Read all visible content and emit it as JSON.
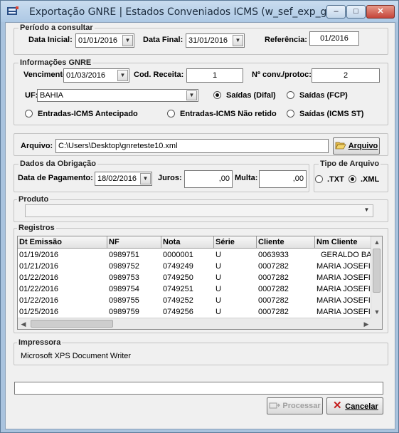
{
  "window": {
    "title": "Exportação GNRE  |  Estados Conveniados ICMS (w_sef_exp_gnre)",
    "min_glyph": "–",
    "max_glyph": "□",
    "close_glyph": "✕"
  },
  "periodo": {
    "legend": "Período a consultar",
    "data_inicial_label": "Data Inicial:",
    "data_inicial_value": "01/01/2016",
    "data_final_label": "Data Final:",
    "data_final_value": "31/01/2016",
    "referencia_label": "Referência:",
    "referencia_value": "01/2016"
  },
  "gnre": {
    "legend": "Informações GNRE",
    "vencimento_label": "Vencimento:",
    "vencimento_value": "01/03/2016",
    "cod_receita_label": "Cod. Receita:",
    "cod_receita_value": "1",
    "nconv_label": "Nº conv./protoc:",
    "nconv_value": "2",
    "uf_label": "UF:",
    "uf_value": "BAHIA",
    "radios": [
      {
        "label": "Saídas (Difal)",
        "selected": true
      },
      {
        "label": "Saídas (FCP)",
        "selected": false
      },
      {
        "label": "Entradas-ICMS Antecipado",
        "selected": false
      },
      {
        "label": "Entradas-ICMS Não retido",
        "selected": false
      },
      {
        "label": "Saídas (ICMS ST)",
        "selected": false
      }
    ]
  },
  "arquivo": {
    "label": "Arquivo:",
    "value": "C:\\Users\\Desktop\\gnreteste10.xml",
    "button_label": "Arquivo"
  },
  "obrigacao": {
    "legend": "Dados da Obrigação",
    "data_pagamento_label": "Data de Pagamento:",
    "data_pagamento_value": "18/02/2016",
    "juros_label": "Juros:",
    "juros_value": ",00",
    "multa_label": "Multa:",
    "multa_value": ",00"
  },
  "tipo_arquivo": {
    "legend": "Tipo de Arquivo",
    "options": [
      {
        "label": ".TXT",
        "selected": false
      },
      {
        "label": ".XML",
        "selected": true
      }
    ]
  },
  "produto": {
    "legend": "Produto",
    "value": ""
  },
  "registros": {
    "legend": "Registros",
    "columns": [
      "Dt Emissão",
      "NF",
      "Nota",
      "Série",
      "Cliente",
      "Nm Cliente"
    ],
    "rows": [
      [
        "01/19/2016",
        "0989751",
        "0000001",
        "U",
        "0063933",
        "GERALDO BA"
      ],
      [
        "01/21/2016",
        "0989752",
        "0749249",
        "U",
        "0007282",
        "MARIA JOSEFI"
      ],
      [
        "01/22/2016",
        "0989753",
        "0749250",
        "U",
        "0007282",
        "MARIA JOSEFI"
      ],
      [
        "01/22/2016",
        "0989754",
        "0749251",
        "U",
        "0007282",
        "MARIA JOSEFI"
      ],
      [
        "01/22/2016",
        "0989755",
        "0749252",
        "U",
        "0007282",
        "MARIA JOSEFI"
      ],
      [
        "01/25/2016",
        "0989759",
        "0749256",
        "U",
        "0007282",
        "MARIA JOSEFI"
      ]
    ]
  },
  "impressora": {
    "legend": "Impressora",
    "value": "Microsoft XPS Document Writer"
  },
  "status": {
    "value": ""
  },
  "actions": {
    "processar_label": "Processar",
    "cancelar_label": "Cancelar"
  }
}
